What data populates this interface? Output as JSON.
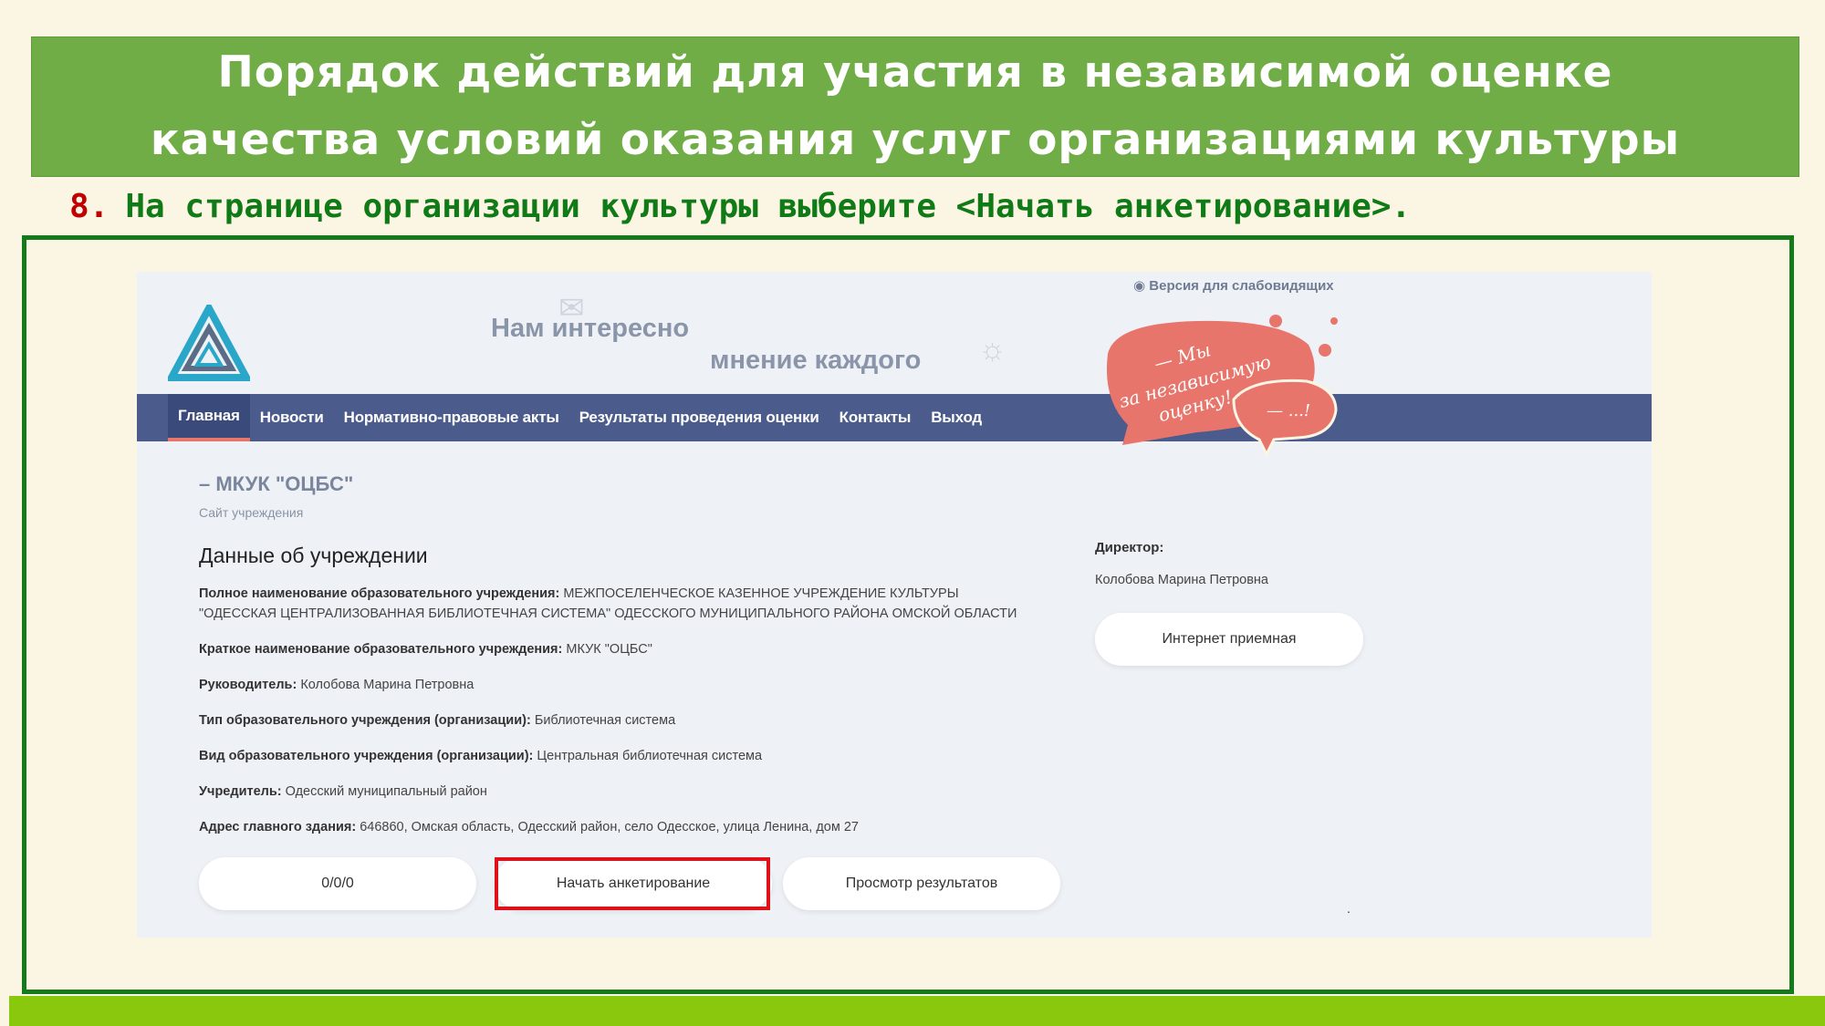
{
  "slide": {
    "title_line1": "Порядок действий для участия в независимой оценке",
    "title_line2": "качества условий оказания услуг организациями культуры",
    "step_number": "8.",
    "step_text": "На странице организации культуры выберите <Начать анкетирование>."
  },
  "site": {
    "slogan_line1": "Нам интересно",
    "slogan_line2": "мнение каждого",
    "vision_link": "Версия для слабовидящих",
    "bubble_text_1": "— Мы",
    "bubble_text_2": "за независимую",
    "bubble_text_3": "оценку!",
    "bubble_text_4": "— ...!",
    "nav": [
      "Главная",
      "Новости",
      "Нормативно-правовые акты",
      "Результаты проведения оценки",
      "Контакты",
      "Выход"
    ],
    "org_title": "– МКУК \"ОЦБС\"",
    "org_subtitle": "Сайт учреждения",
    "section_title": "Данные об учреждении",
    "info": [
      {
        "label": "Полное наименование образовательного учреждения:",
        "value": "МЕЖПОСЕЛЕНЧЕСКОЕ КАЗЕННОЕ УЧРЕЖДЕНИЕ КУЛЬТУРЫ \"ОДЕССКАЯ ЦЕНТРАЛИЗОВАННАЯ БИБЛИОТЕЧНАЯ СИСТЕМА\" ОДЕССКОГО МУНИЦИПАЛЬНОГО РАЙОНА ОМСКОЙ ОБЛАСТИ"
      },
      {
        "label": "Краткое наименование образовательного учреждения:",
        "value": "МКУК \"ОЦБС\""
      },
      {
        "label": "Руководитель:",
        "value": "Колобова Марина Петровна"
      },
      {
        "label": "Тип образовательного учреждения (организации):",
        "value": "Библиотечная система"
      },
      {
        "label": "Вид образовательного учреждения (организации):",
        "value": "Центральная библиотечная система"
      },
      {
        "label": "Учредитель:",
        "value": "Одесский муниципальный район"
      },
      {
        "label": "Адрес главного здания:",
        "value": "646860, Омская область, Одесский район, село Одесское, улица Ленина, дом 27"
      }
    ],
    "director_label": "Директор:",
    "director_name": "Колобова Марина Петровна",
    "reception_button": "Интернет приемная",
    "counter_button": "0/0/0",
    "start_button": "Начать анкетирование",
    "results_button": "Просмотр результатов",
    "dot": "."
  },
  "colors": {
    "title_bg": "#70ad47",
    "step_text": "#0f7a16",
    "step_number": "#c00000",
    "frame_border": "#157a1b",
    "nav_bg": "#4a5b8c",
    "highlight": "#e0101a",
    "bubble": "#e8756b",
    "bottom_bar": "#8ac80e"
  },
  "icons": [
    "triangle-logo-icon",
    "eye-icon",
    "paper-plane-icon",
    "lightbulb-icon",
    "speech-bubble-icon"
  ]
}
